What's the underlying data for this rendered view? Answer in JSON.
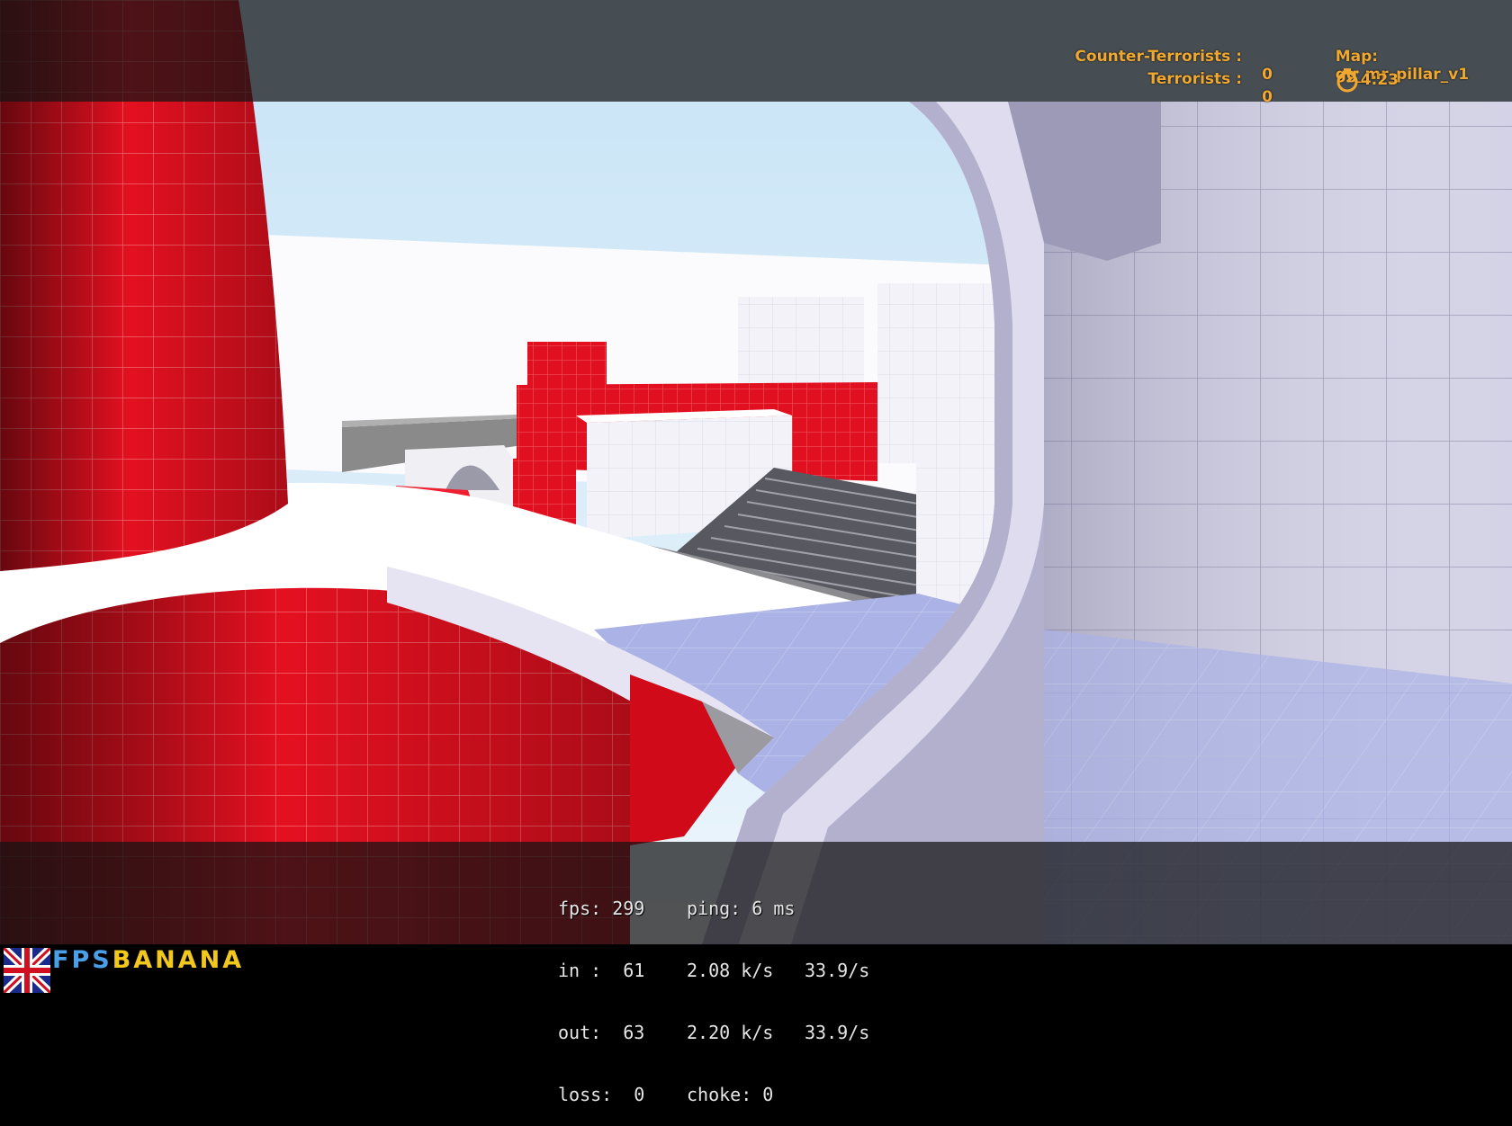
{
  "scoreboard": {
    "ct_label": "Counter-Terrorists :",
    "ct_score": "0",
    "t_label": "Terrorists :",
    "t_score": "0",
    "map_label": "Map:",
    "map_name": "gg_mr_pillar_v1",
    "timer": "4:23"
  },
  "net_graph": {
    "row1": {
      "a": "fps: 299",
      "b": "ping: 6 ms"
    },
    "row2": {
      "a": "in :  61",
      "b": "2.08 k/s",
      "c": "33.9/s"
    },
    "row3": {
      "a": "out:  63",
      "b": "2.20 k/s",
      "c": "33.9/s"
    },
    "row4": {
      "a": "loss:  0",
      "b": "choke: 0"
    }
  },
  "watermark": {
    "part1": "FPS",
    "part2": "BANANA"
  },
  "colors": {
    "hud_text": "#f0a830",
    "wall_red": "#e8101e",
    "wall_white": "#f4f4f8",
    "floor_lavender": "#b4bce8",
    "sky": "#d8ecf8"
  },
  "icons": {
    "timer": "stopwatch-icon",
    "flag": "uk-flag-icon"
  }
}
